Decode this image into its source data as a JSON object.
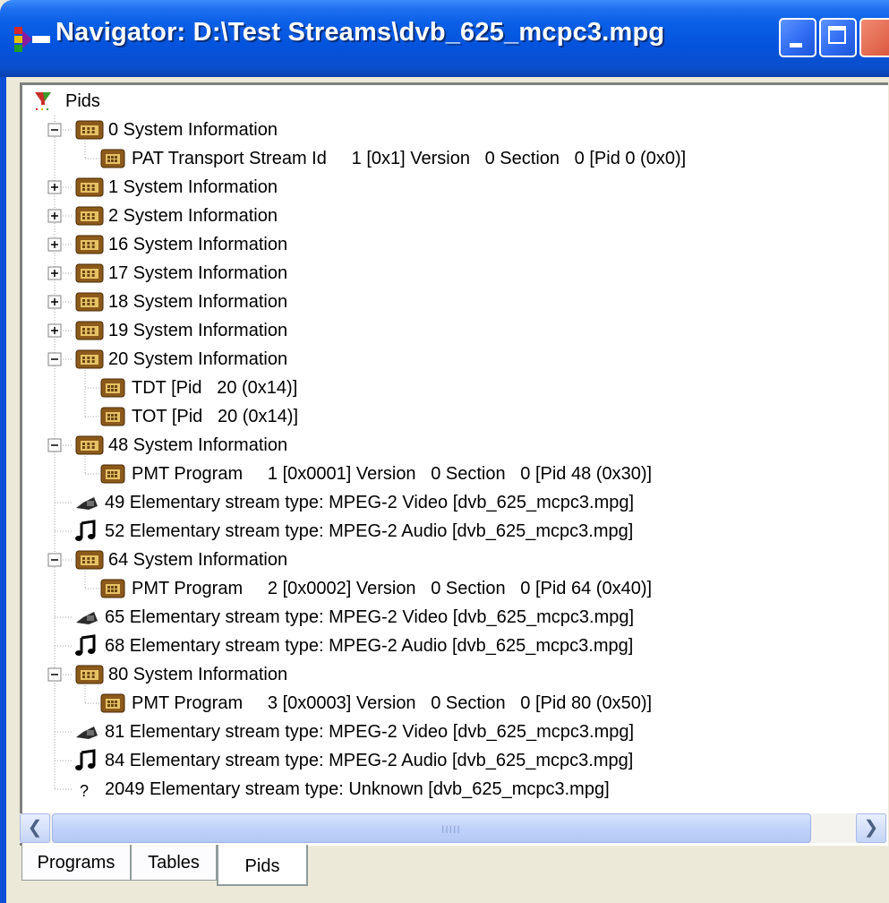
{
  "window": {
    "title": "Navigator: D:\\Test Streams\\dvb_625_mcpc3.mpg"
  },
  "tree": {
    "root_label": "Pids",
    "rows": [
      {
        "level": 0,
        "icon": "filter-icon",
        "expander": "none",
        "label": "Pids"
      },
      {
        "level": 1,
        "icon": "folder-table-icon",
        "expander": "minus",
        "label": "0 System Information"
      },
      {
        "level": 2,
        "icon": "table-icon",
        "expander": "none",
        "label": "PAT Transport Stream Id     1 [0x1] Version   0 Section   0 [Pid 0 (0x0)]"
      },
      {
        "level": 1,
        "icon": "folder-table-icon",
        "expander": "plus",
        "label": "1 System Information"
      },
      {
        "level": 1,
        "icon": "folder-table-icon",
        "expander": "plus",
        "label": "2 System Information"
      },
      {
        "level": 1,
        "icon": "folder-table-icon",
        "expander": "plus",
        "label": "16 System Information"
      },
      {
        "level": 1,
        "icon": "folder-table-icon",
        "expander": "plus",
        "label": "17 System Information"
      },
      {
        "level": 1,
        "icon": "folder-table-icon",
        "expander": "plus",
        "label": "18 System Information"
      },
      {
        "level": 1,
        "icon": "folder-table-icon",
        "expander": "plus",
        "label": "19 System Information"
      },
      {
        "level": 1,
        "icon": "folder-table-icon",
        "expander": "minus",
        "label": "20 System Information"
      },
      {
        "level": 2,
        "icon": "table-icon",
        "expander": "none",
        "label": "TDT [Pid   20 (0x14)]"
      },
      {
        "level": 2,
        "icon": "table-icon",
        "expander": "none",
        "label": "TOT [Pid   20 (0x14)]"
      },
      {
        "level": 1,
        "icon": "folder-table-icon",
        "expander": "minus",
        "label": "48 System Information"
      },
      {
        "level": 2,
        "icon": "table-icon",
        "expander": "none",
        "label": "PMT Program     1 [0x0001] Version   0 Section   0 [Pid 48 (0x30)]"
      },
      {
        "level": 1,
        "icon": "video-camera-icon",
        "expander": "none",
        "label": "49 Elementary stream type: MPEG-2 Video [dvb_625_mcpc3.mpg]"
      },
      {
        "level": 1,
        "icon": "music-note-icon",
        "expander": "none",
        "label": "52 Elementary stream type: MPEG-2 Audio [dvb_625_mcpc3.mpg]"
      },
      {
        "level": 1,
        "icon": "folder-table-icon",
        "expander": "minus",
        "label": "64 System Information"
      },
      {
        "level": 2,
        "icon": "table-icon",
        "expander": "none",
        "label": "PMT Program     2 [0x0002] Version   0 Section   0 [Pid 64 (0x40)]"
      },
      {
        "level": 1,
        "icon": "video-camera-icon",
        "expander": "none",
        "label": "65 Elementary stream type: MPEG-2 Video [dvb_625_mcpc3.mpg]"
      },
      {
        "level": 1,
        "icon": "music-note-icon",
        "expander": "none",
        "label": "68 Elementary stream type: MPEG-2 Audio [dvb_625_mcpc3.mpg]"
      },
      {
        "level": 1,
        "icon": "folder-table-icon",
        "expander": "minus",
        "label": "80 System Information"
      },
      {
        "level": 2,
        "icon": "table-icon",
        "expander": "none",
        "label": "PMT Program     3 [0x0003] Version   0 Section   0 [Pid 80 (0x50)]"
      },
      {
        "level": 1,
        "icon": "video-camera-icon",
        "expander": "none",
        "label": "81 Elementary stream type: MPEG-2 Video [dvb_625_mcpc3.mpg]"
      },
      {
        "level": 1,
        "icon": "music-note-icon",
        "expander": "none",
        "label": "84 Elementary stream type: MPEG-2 Audio [dvb_625_mcpc3.mpg]"
      },
      {
        "level": 1,
        "icon": "unknown-stream-icon",
        "expander": "none",
        "label": "2049 Elementary stream type: Unknown [dvb_625_mcpc3.mpg]"
      }
    ]
  },
  "tabs": {
    "programs": "Programs",
    "tables": "Tables",
    "pids": "Pids",
    "active": "Pids"
  },
  "colors": {
    "titlebar": "#0453dd",
    "window_bg": "#ece9d8",
    "icon_brown": "#8b5a1a",
    "icon_gold": "#e7c267"
  }
}
